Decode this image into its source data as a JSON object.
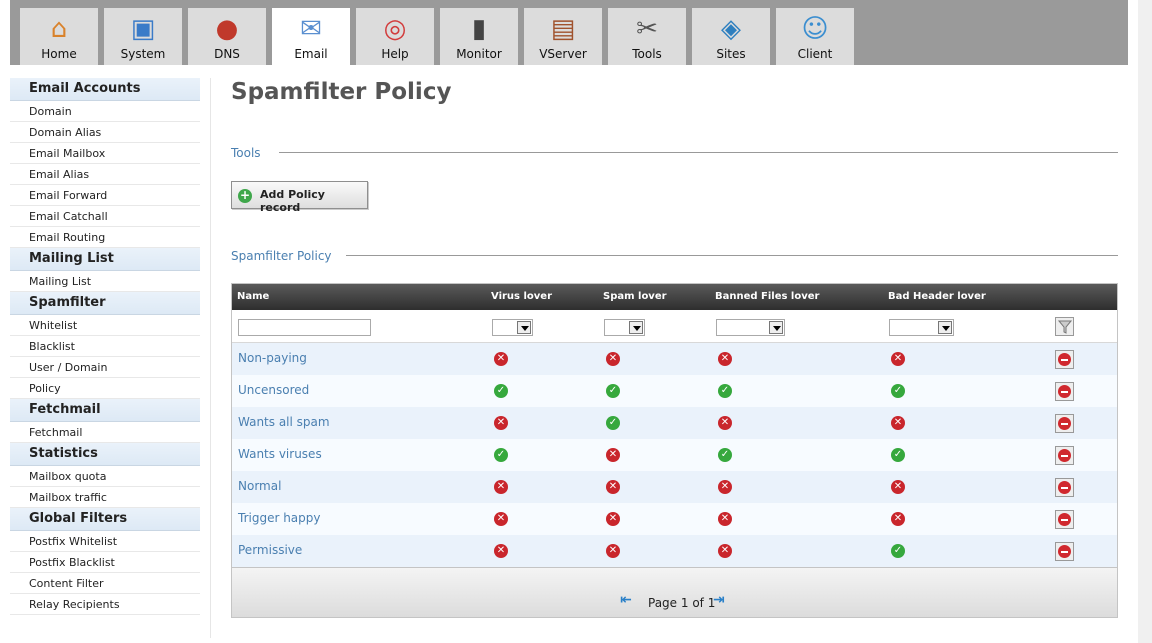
{
  "tabs": [
    {
      "label": "Home",
      "icon": "home-icon"
    },
    {
      "label": "System",
      "icon": "computer-icon"
    },
    {
      "label": "DNS",
      "icon": "dns-icon"
    },
    {
      "label": "Email",
      "icon": "envelope-icon"
    },
    {
      "label": "Help",
      "icon": "lifebuoy-icon"
    },
    {
      "label": "Monitor",
      "icon": "traffic-light-icon"
    },
    {
      "label": "VServer",
      "icon": "cabinet-icon"
    },
    {
      "label": "Tools",
      "icon": "tools-icon"
    },
    {
      "label": "Sites",
      "icon": "sites-icon"
    },
    {
      "label": "Client",
      "icon": "users-icon"
    }
  ],
  "active_tab": "Email",
  "sidebar": {
    "groups": [
      {
        "title": "Email Accounts",
        "items": [
          "Domain",
          "Domain Alias",
          "Email Mailbox",
          "Email Alias",
          "Email Forward",
          "Email Catchall",
          "Email Routing"
        ]
      },
      {
        "title": "Mailing List",
        "items": [
          "Mailing List"
        ]
      },
      {
        "title": "Spamfilter",
        "items": [
          "Whitelist",
          "Blacklist",
          "User / Domain",
          "Policy"
        ]
      },
      {
        "title": "Fetchmail",
        "items": [
          "Fetchmail"
        ]
      },
      {
        "title": "Statistics",
        "items": [
          "Mailbox quota",
          "Mailbox traffic"
        ]
      },
      {
        "title": "Global Filters",
        "items": [
          "Postfix Whitelist",
          "Postfix Blacklist",
          "Content Filter",
          "Relay Recipients"
        ]
      }
    ]
  },
  "main": {
    "title": "Spamfilter Policy",
    "tools_label": "Tools",
    "add_button": "Add Policy record",
    "list_label": "Spamfilter Policy",
    "columns": [
      "Name",
      "Virus lover",
      "Spam lover",
      "Banned Files lover",
      "Bad Header lover"
    ],
    "rows": [
      {
        "name": "Non-paying",
        "values": [
          false,
          false,
          false,
          false
        ]
      },
      {
        "name": "Uncensored",
        "values": [
          true,
          true,
          true,
          true
        ]
      },
      {
        "name": "Wants all spam",
        "values": [
          false,
          true,
          false,
          false
        ]
      },
      {
        "name": "Wants viruses",
        "values": [
          true,
          false,
          true,
          true
        ]
      },
      {
        "name": "Normal",
        "values": [
          false,
          false,
          false,
          false
        ]
      },
      {
        "name": "Trigger happy",
        "values": [
          false,
          false,
          false,
          false
        ]
      },
      {
        "name": "Permissive",
        "values": [
          false,
          false,
          false,
          true
        ]
      }
    ],
    "pager_text": "Page 1 of 1"
  },
  "colors": {
    "accent": "#4a7fb0",
    "ok": "#36a83d",
    "no": "#c9262c"
  }
}
